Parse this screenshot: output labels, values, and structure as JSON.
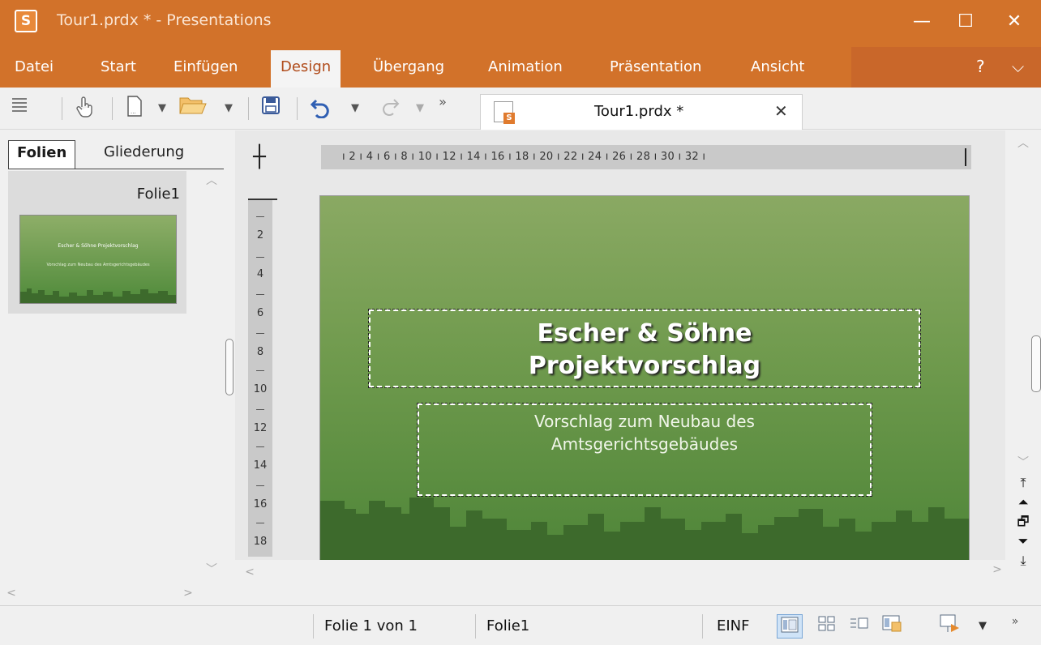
{
  "window": {
    "app_icon": "S",
    "title": "Tour1.prdx * - Presentations",
    "minimize": "—",
    "maximize": "☐",
    "close": "✕"
  },
  "menu": {
    "items": [
      "Datei",
      "Start",
      "Einfügen",
      "Design",
      "Übergang",
      "Animation",
      "Präsentation",
      "Ansicht"
    ],
    "active": "Design",
    "help": "?",
    "collapse": "⌵"
  },
  "toolbar": {
    "icons": [
      "menu-icon",
      "touch-hand-icon",
      "new-document-icon",
      "open-folder-icon",
      "save-icon",
      "undo-icon",
      "redo-icon"
    ],
    "overflow": "»"
  },
  "document_tab": {
    "label": "Tour1.prdx *",
    "close": "✕"
  },
  "left_pane": {
    "tabs": [
      "Folien",
      "Gliederung"
    ],
    "active_tab": "Folien",
    "thumbnail_label": "Folie1",
    "thumb_title": "Escher & Söhne Projektvorschlag",
    "thumb_subtitle": "Vorschlag zum Neubau des Amtsgerichtsgebäudes"
  },
  "ruler": {
    "horizontal": "ı 2 ı 4 ı 6 ı 8 ı 10 ı 12 ı 14 ı 16 ı 18 ı 20 ı 22 ı 24 ı 26 ı 28 ı 30 ı 32 ı",
    "vertical": [
      "2",
      "4",
      "6",
      "8",
      "10",
      "12",
      "14",
      "16",
      "18"
    ]
  },
  "slide": {
    "title_line1": "Escher & Söhne",
    "title_line2": "Projektvorschlag",
    "subtitle_line1": "Vorschlag zum Neubau des",
    "subtitle_line2": "Amtsgerichtsgebäudes"
  },
  "status": {
    "slide_position": "Folie 1 von 1",
    "slide_name": "Folie1",
    "mode": "EINF",
    "overflow": "»"
  },
  "colors": {
    "accent": "#d2722a",
    "slide_top": "#8aa963",
    "slide_bottom": "#4e8538",
    "skyline": "#3d6a2c"
  }
}
